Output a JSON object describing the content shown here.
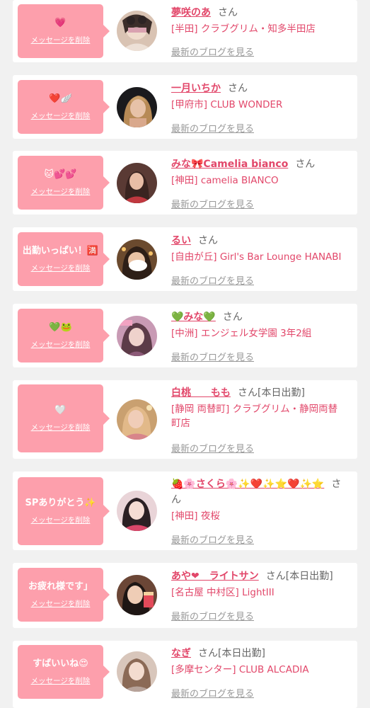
{
  "delete_label": "メッセージを削除",
  "blog_label": "最新のブログを見る",
  "san_label": "さん",
  "entries": [
    {
      "message": "💗",
      "name": "夢咲のあ",
      "san_suffix": "",
      "shop": "[半田] クラブグリム・知多半田店"
    },
    {
      "message": "❤️🪽",
      "name": "一月いちか",
      "san_suffix": "",
      "shop": "[甲府市] CLUB WONDER"
    },
    {
      "message": "🐱💕💕",
      "name": "みな🎀Camelia bianco",
      "san_suffix": "",
      "shop": "[神田] camelia BIANCO"
    },
    {
      "message": "出勤いっぱい！🈵",
      "name": "るい",
      "san_suffix": "",
      "shop": "[自由が丘] Girl's Bar Lounge HANABI"
    },
    {
      "message": "💚🐸",
      "name": "💚みな💚",
      "san_suffix": "",
      "shop": "[中洲] エンジェル女学園 3年2組"
    },
    {
      "message": "🤍",
      "name": "白桃　　もも",
      "san_suffix": "[本日出勤]",
      "shop": "[静岡 両替町] クラブグリム・静岡両替町店"
    },
    {
      "message": "SPありがとう✨",
      "name": "🍓🌸さくら🌸✨❤️✨⭐️❤️✨⭐️",
      "san_suffix": "",
      "shop": "[神田] 夜桜"
    },
    {
      "message": "お疲れ様です」",
      "name": "あや❤︎　ライトサン",
      "san_suffix": "[本日出勤]",
      "shop": "[名古屋 中村区] LightIII"
    },
    {
      "message": "すばいいね😍",
      "name": "なぎ",
      "san_suffix": "[本日出勤]",
      "shop": "[多摩センター] CLUB ALCADIA"
    }
  ]
}
